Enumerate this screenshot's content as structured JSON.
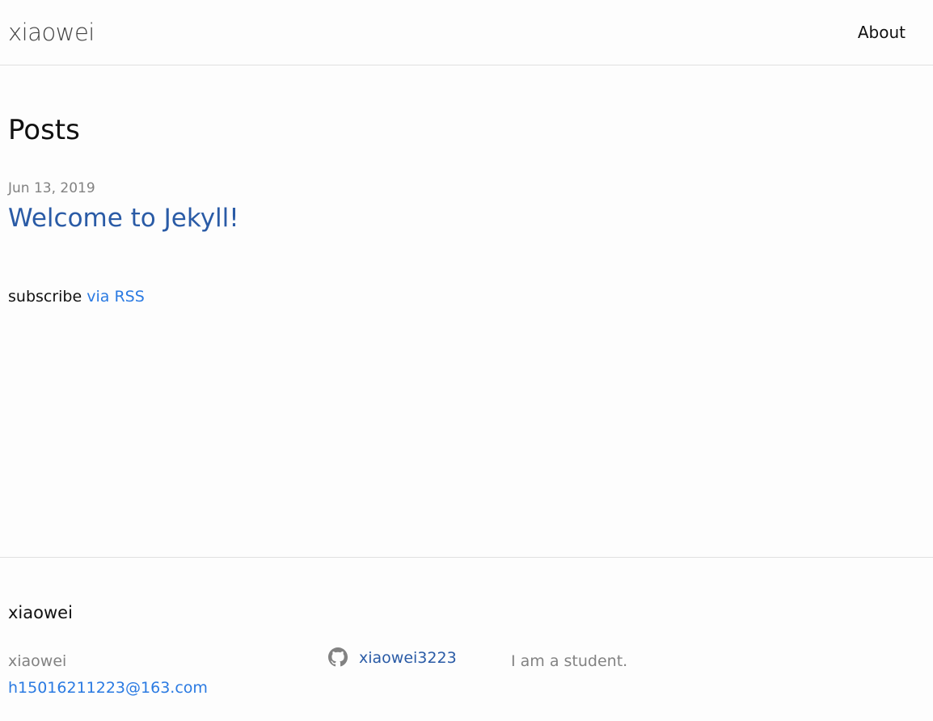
{
  "header": {
    "site_title": "xiaowei",
    "nav": [
      {
        "label": "About"
      }
    ]
  },
  "main": {
    "heading": "Posts",
    "posts": [
      {
        "date": "Jun 13, 2019",
        "title": "Welcome to Jekyll!"
      }
    ],
    "rss": {
      "prefix": "subscribe",
      "link_text": "via RSS"
    }
  },
  "footer": {
    "heading": "xiaowei",
    "name": "xiaowei",
    "email": "h15016211223@163.com",
    "github_username": "xiaowei3223",
    "github_icon": "github-icon",
    "description": "I am a student."
  },
  "colors": {
    "link": "#2a7ae2",
    "visited_link": "#2a5ba6",
    "meta_text": "#828282",
    "border": "#e0e0e0",
    "background": "#fdfdfd"
  }
}
